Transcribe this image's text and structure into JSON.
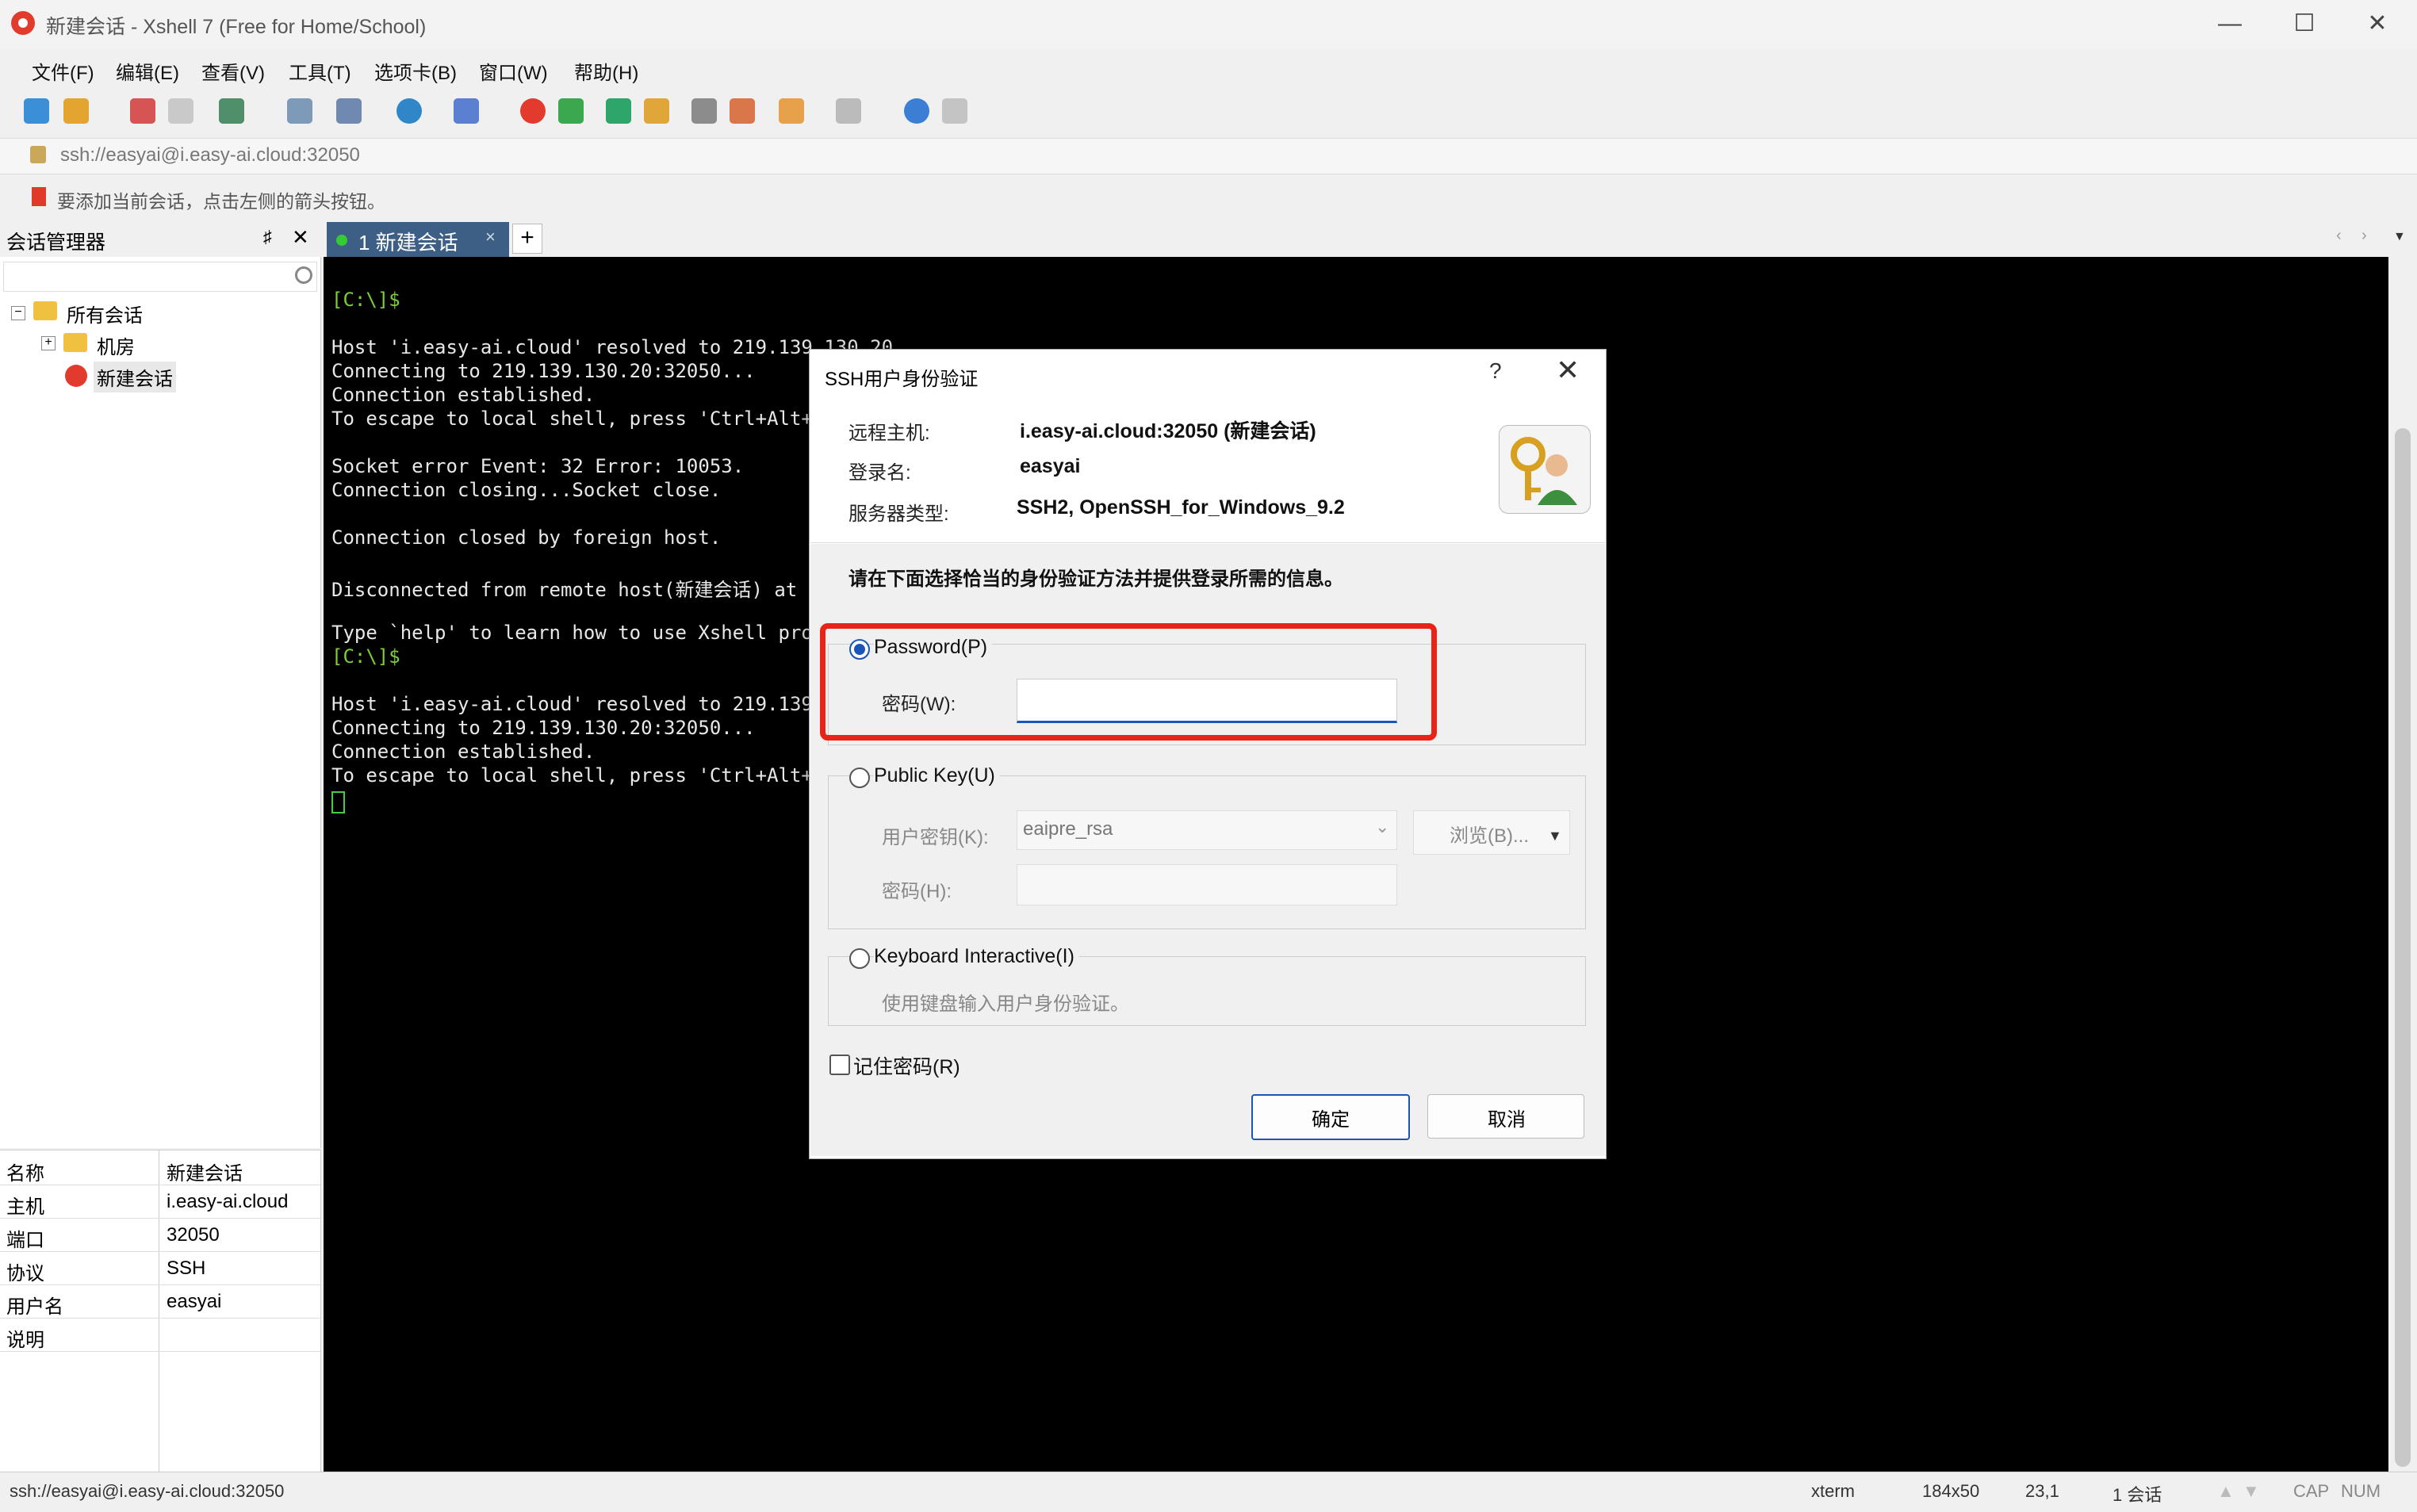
{
  "window": {
    "title": "新建会话 - Xshell 7 (Free for Home/School)",
    "minimize": "—",
    "maximize": "☐",
    "close": "✕"
  },
  "menu": [
    "文件(F)",
    "编辑(E)",
    "查看(V)",
    "工具(T)",
    "选项卡(B)",
    "窗口(W)",
    "帮助(H)"
  ],
  "address": "ssh://easyai@i.easy-ai.cloud:32050",
  "hint": "要添加当前会话，点击左侧的箭头按钮。",
  "session_manager": {
    "title": "会话管理器",
    "pin": "♯",
    "close": "✕",
    "tree": [
      "所有会话",
      "机房",
      "新建会话"
    ],
    "props": [
      {
        "k": "名称",
        "v": "新建会话"
      },
      {
        "k": "主机",
        "v": "i.easy-ai.cloud"
      },
      {
        "k": "端口",
        "v": "32050"
      },
      {
        "k": "协议",
        "v": "SSH"
      },
      {
        "k": "用户名",
        "v": "easyai"
      },
      {
        "k": "说明",
        "v": ""
      }
    ]
  },
  "tab": {
    "label": "1 新建会话",
    "close": "×",
    "add": "+"
  },
  "terminal": [
    "[C:\\]$",
    "",
    "Host 'i.easy-ai.cloud' resolved to 219.139.130.20",
    "Connecting to 219.139.130.20:32050...",
    "Connection established.",
    "To escape to local shell, press 'Ctrl+Alt+]",
    "",
    "Socket error Event: 32 Error: 10053.",
    "Connection closing...Socket close.",
    "",
    "Connection closed by foreign host.",
    "",
    "Disconnected from remote host(新建会话) at",
    "",
    "Type `help' to learn how to use Xshell prom",
    "[C:\\]$",
    "",
    "Host 'i.easy-ai.cloud' resolved to 219.139.",
    "Connecting to 219.139.130.20:32050...",
    "Connection established.",
    "To escape to local shell, press 'Ctrl+Alt+]"
  ],
  "status": {
    "left": "ssh://easyai@i.easy-ai.cloud:32050",
    "term": "xterm",
    "size": "184x50",
    "pos": "23,1",
    "sessions": "1 会话",
    "cap": "CAP",
    "num": "NUM"
  },
  "dialog": {
    "title": "SSH用户身份验证",
    "help": "?",
    "close": "✕",
    "remote_host_label": "远程主机:",
    "remote_host": "i.easy-ai.cloud:32050 (新建会话)",
    "login_label": "登录名:",
    "login": "easyai",
    "server_type_label": "服务器类型:",
    "server_type": "SSH2, OpenSSH_for_Windows_9.2",
    "instruction": "请在下面选择恰当的身份验证方法并提供登录所需的信息。",
    "password_option": "Password(P)",
    "password_label": "密码(W):",
    "password_value": "",
    "pubkey_option": "Public Key(U)",
    "user_key_label": "用户密钥(K):",
    "user_key_value": "eaipre_rsa",
    "browse": "浏览(B)...",
    "passphrase_label": "密码(H):",
    "kbd_option": "Keyboard Interactive(I)",
    "kbd_desc": "使用键盘输入用户身份验证。",
    "remember": "记住密码(R)",
    "ok": "确定",
    "cancel": "取消"
  }
}
